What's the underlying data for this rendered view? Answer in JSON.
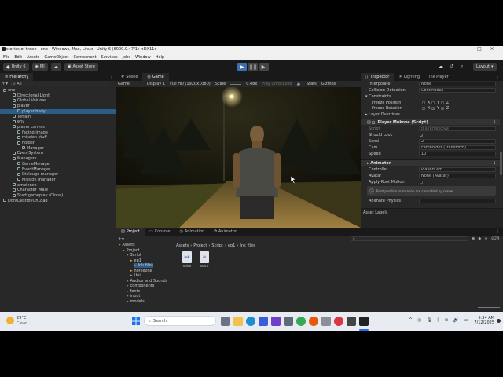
{
  "window": {
    "title": "stories of those - one - Windows, Mac, Linux - Unity 6 (6000.0.47f1) <DX11>"
  },
  "menu": [
    "File",
    "Edit",
    "Assets",
    "GameObject",
    "Component",
    "Services",
    "Jobs",
    "Window",
    "Help"
  ],
  "toolbar": {
    "account": "Unity 6",
    "mi": "MI",
    "asset_store": "Asset Store",
    "layout": "Layout"
  },
  "hierarchy": {
    "tab": "Hierarchy",
    "search_placeholder": "All",
    "items": [
      {
        "label": "one",
        "indent": 0
      },
      {
        "label": "Directional Light",
        "indent": 2
      },
      {
        "label": "Global Volume",
        "indent": 2
      },
      {
        "label": "player",
        "indent": 2
      },
      {
        "label": "player body",
        "indent": 3
      },
      {
        "label": "Terrain",
        "indent": 2
      },
      {
        "label": "env",
        "indent": 2
      },
      {
        "label": "player canvas",
        "indent": 2
      },
      {
        "label": "fading image",
        "indent": 3
      },
      {
        "label": "mission stuff",
        "indent": 3
      },
      {
        "label": "holder",
        "indent": 3
      },
      {
        "label": "Manager",
        "indent": 4
      },
      {
        "label": "EventSystem",
        "indent": 2
      },
      {
        "label": "Managers",
        "indent": 2
      },
      {
        "label": "GameManager",
        "indent": 3
      },
      {
        "label": "EventManager",
        "indent": 3
      },
      {
        "label": "Dialouge manager",
        "indent": 3
      },
      {
        "label": "Mission manager",
        "indent": 3
      },
      {
        "label": "ambience",
        "indent": 2
      },
      {
        "label": "Character_Male",
        "indent": 2
      },
      {
        "label": "Start gameplay (Clone)",
        "indent": 2
      },
      {
        "label": "DontDestroyOnLoad",
        "indent": 0
      }
    ]
  },
  "scene_tabs": [
    "Scene",
    "Game"
  ],
  "game_toolbar": {
    "mode": "Game",
    "display": "Display 1",
    "resolution": "Full HD (1920x1080)",
    "scale_label": "Scale",
    "scale_value": "0.48x",
    "play_unfocused": "Play Unfocused",
    "stats": "Stats",
    "gizmos": "Gizmos"
  },
  "inspector": {
    "tabs": [
      "Inspector",
      "Lighting",
      "Ink Player"
    ],
    "rows": [
      {
        "label": "Interpolate",
        "value": "None"
      },
      {
        "label": "Collision Detection",
        "value": "Continuous"
      }
    ],
    "constraints": "Constraints",
    "freeze_position": "Freeze Position",
    "freeze_rotation": "Freeze Rotation",
    "axes": [
      "X",
      "Y",
      "Z"
    ],
    "layer_overrides": "Layer Overrides",
    "component": "Player Mokove (Script)",
    "script_label": "Script",
    "script_value": "playerMokove",
    "fields": [
      {
        "label": "Should Look",
        "value": "✓"
      },
      {
        "label": "Sensi",
        "value": "2"
      },
      {
        "label": "Cam",
        "value": "camholder (Transform)"
      },
      {
        "label": "Speed",
        "value": "10"
      }
    ],
    "animator": "Animator",
    "anim_fields": [
      {
        "label": "Controller",
        "value": "PlayerCam"
      },
      {
        "label": "Avatar",
        "value": "None (Avatar)"
      },
      {
        "label": "Apply Root Motion",
        "value": ""
      }
    ],
    "info": "Root position or rotation are controlled by curves",
    "animate_physics": "Animate Physics",
    "asset_labels": "Asset Labels"
  },
  "bottom": {
    "tabs": [
      "Project",
      "Console",
      "Animation",
      "Animator"
    ],
    "breadcrumb": [
      "Assets",
      "Project",
      "Script",
      "ep1",
      "Ink files"
    ],
    "tree": [
      {
        "label": "Assets",
        "indent": 0
      },
      {
        "label": "Project",
        "indent": 1
      },
      {
        "label": "Script",
        "indent": 2
      },
      {
        "label": "ep1",
        "indent": 3
      },
      {
        "label": "Ink files",
        "indent": 4
      },
      {
        "label": "horseone",
        "indent": 3
      },
      {
        "label": "Uni",
        "indent": 3
      },
      {
        "label": "Audios and Sounds",
        "indent": 2
      },
      {
        "label": "components",
        "indent": 2
      },
      {
        "label": "fonts",
        "indent": 2
      },
      {
        "label": "input",
        "indent": 2
      },
      {
        "label": "models",
        "indent": 2
      }
    ],
    "files": [
      {
        "name": "voice",
        "type": "ink"
      },
      {
        "name": "voice",
        "type": "doc"
      }
    ],
    "count": "24"
  },
  "taskbar": {
    "weather_temp": "29°C",
    "weather_desc": "Clear",
    "search": "Search",
    "time": "5:34 AM",
    "date": "7/12/2025"
  }
}
